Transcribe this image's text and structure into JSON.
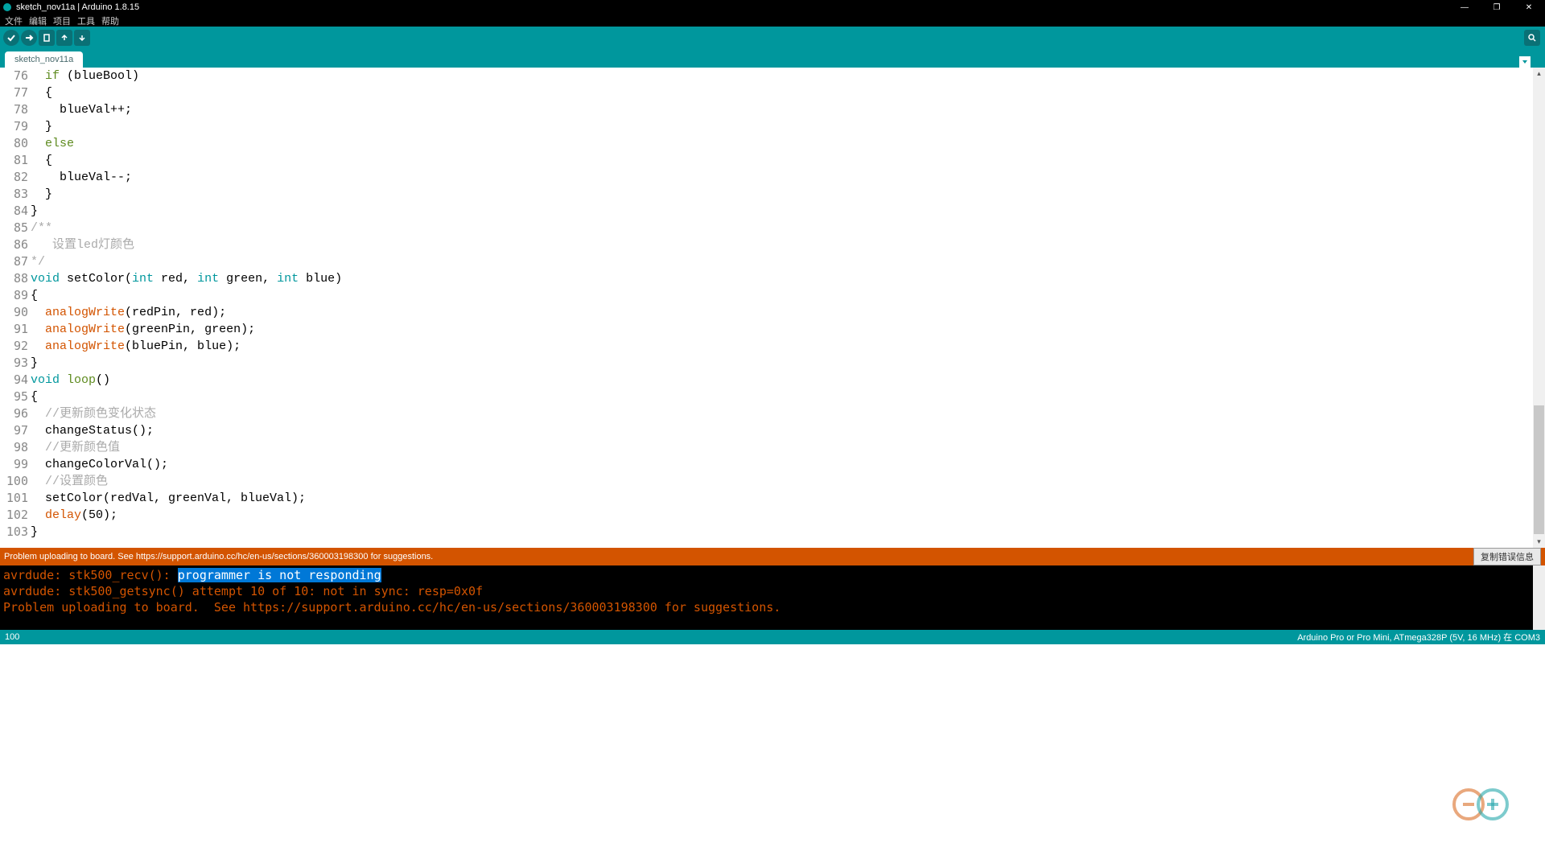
{
  "titlebar": {
    "title": "sketch_nov11a | Arduino 1.8.15"
  },
  "menubar": {
    "items": [
      "文件",
      "编辑",
      "项目",
      "工具",
      "帮助"
    ]
  },
  "tabs": {
    "active": "sketch_nov11a"
  },
  "gutter": {
    "start": 76,
    "end": 103
  },
  "code_lines": [
    [
      {
        "t": "  "
      },
      {
        "t": "if",
        "c": "kw-control"
      },
      {
        "t": " (blueBool)"
      }
    ],
    [
      {
        "t": "  {"
      }
    ],
    [
      {
        "t": "    blueVal++;"
      }
    ],
    [
      {
        "t": "  }"
      }
    ],
    [
      {
        "t": "  "
      },
      {
        "t": "else",
        "c": "kw-control"
      }
    ],
    [
      {
        "t": "  {"
      }
    ],
    [
      {
        "t": "    blueVal--;"
      }
    ],
    [
      {
        "t": "  }"
      }
    ],
    [
      {
        "t": "}"
      }
    ],
    [
      {
        "t": "/**",
        "c": "kw-comment"
      }
    ],
    [
      {
        "t": "   设置led灯颜色",
        "c": "kw-comment"
      }
    ],
    [
      {
        "t": "*/",
        "c": "kw-comment"
      }
    ],
    [
      {
        "t": "void",
        "c": "kw-type"
      },
      {
        "t": " setColor("
      },
      {
        "t": "int",
        "c": "kw-type"
      },
      {
        "t": " red, "
      },
      {
        "t": "int",
        "c": "kw-type"
      },
      {
        "t": " green, "
      },
      {
        "t": "int",
        "c": "kw-type"
      },
      {
        "t": " blue)"
      }
    ],
    [
      {
        "t": "{"
      }
    ],
    [
      {
        "t": "  "
      },
      {
        "t": "analogWrite",
        "c": "kw-func"
      },
      {
        "t": "(redPin, red);"
      }
    ],
    [
      {
        "t": "  "
      },
      {
        "t": "analogWrite",
        "c": "kw-func"
      },
      {
        "t": "(greenPin, green);"
      }
    ],
    [
      {
        "t": "  "
      },
      {
        "t": "analogWrite",
        "c": "kw-func"
      },
      {
        "t": "(bluePin, blue);"
      }
    ],
    [
      {
        "t": "}"
      }
    ],
    [
      {
        "t": "void",
        "c": "kw-type"
      },
      {
        "t": " "
      },
      {
        "t": "loop",
        "c": "kw-control"
      },
      {
        "t": "()"
      }
    ],
    [
      {
        "t": "{"
      }
    ],
    [
      {
        "t": "  //更新颜色变化状态",
        "c": "kw-comment"
      }
    ],
    [
      {
        "t": "  changeStatus();"
      }
    ],
    [
      {
        "t": "  //更新颜色值",
        "c": "kw-comment"
      }
    ],
    [
      {
        "t": "  changeColorVal();"
      }
    ],
    [
      {
        "t": "  //设置颜色",
        "c": "kw-comment"
      }
    ],
    [
      {
        "t": "  setColor(redVal, greenVal, blueVal);"
      }
    ],
    [
      {
        "t": "  "
      },
      {
        "t": "delay",
        "c": "kw-func"
      },
      {
        "t": "(50);"
      }
    ],
    [
      {
        "t": "}"
      }
    ]
  ],
  "status_orange": {
    "text": "Problem uploading to board.  See https://support.arduino.cc/hc/en-us/sections/360003198300 for suggestions.",
    "copy_btn": "复制错误信息"
  },
  "console": {
    "line1_prefix": "avrdude: stk500_recv(): ",
    "line1_highlight": "programmer is not responding",
    "line2": "avrdude: stk500_getsync() attempt 10 of 10: not in sync: resp=0x0f",
    "line3": "Problem uploading to board.  See https://support.arduino.cc/hc/en-us/sections/360003198300 for suggestions."
  },
  "bottombar": {
    "left": "100",
    "right": "Arduino Pro or Pro Mini, ATmega328P (5V, 16 MHz) 在 COM3"
  }
}
